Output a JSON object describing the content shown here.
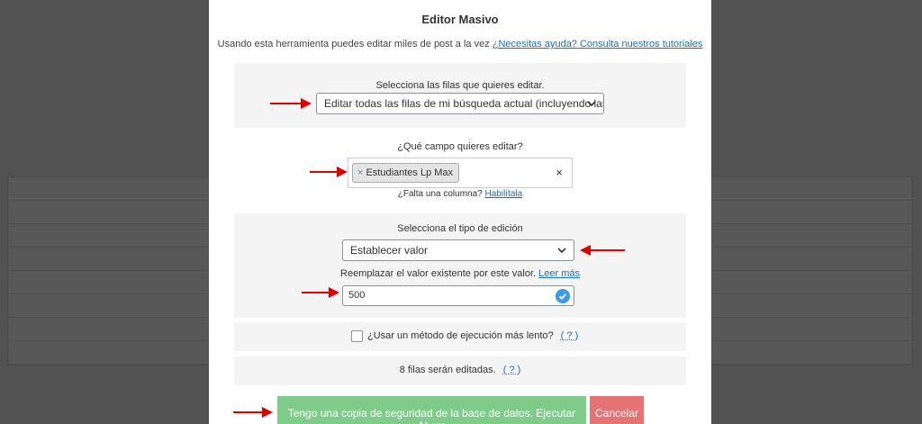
{
  "modal": {
    "title": "Editor Masivo",
    "intro_text": "Usando esta herramienta puedes editar miles de post a la vez ",
    "intro_link": "¿Necesitas ayuda? Consulta nuestros tutoriales"
  },
  "rows_section": {
    "label": "Selecciona las filas que quieres editar.",
    "selected": "Editar todas las filas de mi búsqueda actual (incluyendo las"
  },
  "field_section": {
    "label": "¿Qué campo quieres editar?",
    "tag": "Estudiantes Lp Max",
    "clear_icon": "×",
    "missing_text": "¿Falta una columna? ",
    "missing_link": "Habilítala"
  },
  "edit_type_section": {
    "label": "Selecciona el tipo de edición",
    "selected": "Establecer valor",
    "description": "Reemplazar el valor existente por este valor. ",
    "description_link": "Leer más",
    "value": "500"
  },
  "slow_method": {
    "label": "¿Usar un método de ejecución más lento?",
    "help": "( ? )"
  },
  "summary": {
    "text": "8 filas serán editadas.",
    "help": "( ? )"
  },
  "buttons": {
    "run": "Tengo una copia de seguridad de la base de datos. Ejecutar Ahora",
    "cancel": "Cancelar"
  },
  "colors": {
    "run_button": "#7ecb8a",
    "cancel_button": "#e57373",
    "link": "#1f6fb5",
    "annotation_arrow": "#e00000"
  }
}
